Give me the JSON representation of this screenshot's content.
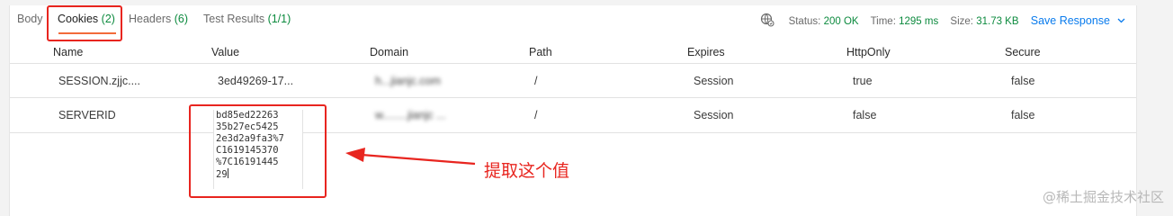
{
  "tabs": [
    {
      "label": "Body",
      "count": ""
    },
    {
      "label": "Cookies",
      "count": "(2)"
    },
    {
      "label": "Headers",
      "count": "(6)"
    },
    {
      "label": "Test Results",
      "count": "(1/1)"
    }
  ],
  "status": {
    "status_label": "Status:",
    "status_value": "200 OK",
    "time_label": "Time:",
    "time_value": "1295 ms",
    "size_label": "Size:",
    "size_value": "31.73 KB",
    "save_label": "Save Response"
  },
  "table": {
    "headers": [
      "Name",
      "Value",
      "Domain",
      "Path",
      "Expires",
      "HttpOnly",
      "Secure"
    ],
    "rows": [
      {
        "name": "SESSION.zjjc....",
        "value": "3ed49269-17...",
        "domain": "h...jianjc.com",
        "path": "/",
        "expires": "Session",
        "httponly": "true",
        "secure": "false"
      },
      {
        "name": "SERVERID",
        "value": "",
        "domain": "w........jianjc ...",
        "path": "/",
        "expires": "Session",
        "httponly": "false",
        "secure": "false"
      }
    ]
  },
  "value_editor": {
    "lines": [
      "bd85ed22263",
      "35b27ec5425",
      "2e3d2a9fa3%7",
      "C1619145370",
      "%7C16191445",
      "29"
    ]
  },
  "annotation": "提取这个值",
  "watermark": "@稀土掘金技术社区",
  "colors": {
    "accent_orange": "#f26b3a",
    "success_green": "#0c8a3e",
    "link_blue": "#097bed",
    "annotation_red": "#e8251f"
  }
}
